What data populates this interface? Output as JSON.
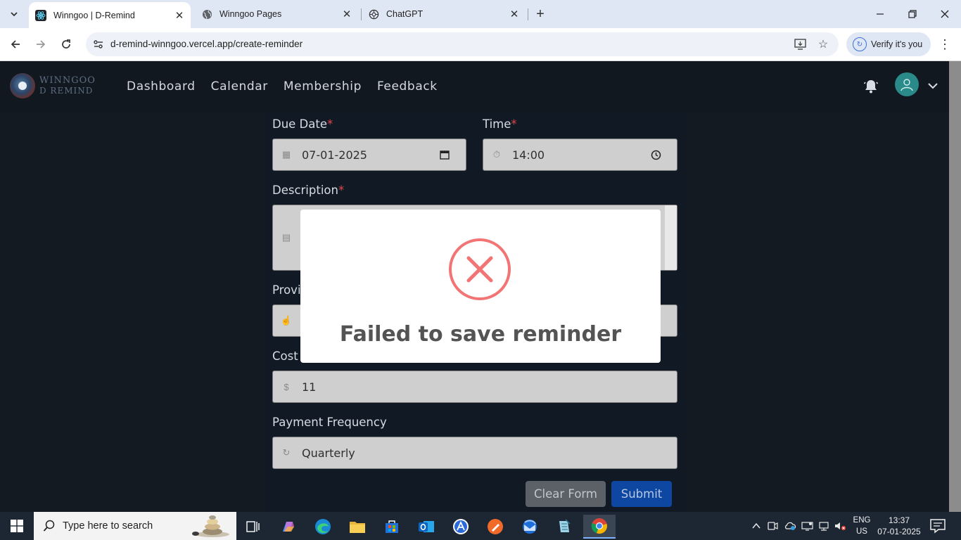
{
  "browser": {
    "tabs": [
      {
        "title": "Winngoo | D-Remind",
        "active": true
      },
      {
        "title": "Winngoo Pages",
        "active": false
      },
      {
        "title": "ChatGPT",
        "active": false
      }
    ],
    "url": "d-remind-winngoo.vercel.app/create-reminder",
    "verify_label": "Verify it's you"
  },
  "app": {
    "logo": {
      "line1": "WINNGOO",
      "line2": "D REMIND"
    },
    "nav": [
      "Dashboard",
      "Calendar",
      "Membership",
      "Feedback"
    ],
    "form": {
      "due_date": {
        "label": "Due Date",
        "value": "07-01-2025"
      },
      "time": {
        "label": "Time",
        "value": "14:00"
      },
      "description": {
        "label": "Description",
        "value": ""
      },
      "provider": {
        "label": "Provi",
        "value": ""
      },
      "cost": {
        "label": "Cost",
        "value": "11"
      },
      "payment_frequency": {
        "label": "Payment Frequency",
        "value": "Quarterly"
      },
      "required_mark": "*"
    },
    "buttons": {
      "clear": "Clear Form",
      "submit": "Submit"
    },
    "modal": {
      "title": "Failed to save reminder",
      "icon": "error-x-icon"
    },
    "colors": {
      "accent_error": "#f27474",
      "submit": "#0d47a1",
      "nav_bg": "#111820"
    }
  },
  "taskbar": {
    "search_placeholder": "Type here to search",
    "lang": {
      "line1": "ENG",
      "line2": "US"
    },
    "time": "13:37",
    "date": "07-01-2025"
  }
}
